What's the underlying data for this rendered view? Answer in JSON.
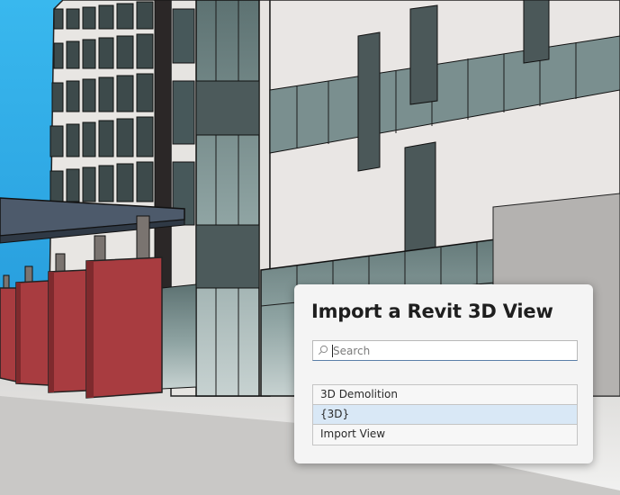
{
  "dialog": {
    "title": "Import a Revit 3D View",
    "search": {
      "placeholder": "Search",
      "value": "",
      "icon": "search-icon"
    },
    "views": [
      {
        "label": "3D Demolition",
        "selected": false
      },
      {
        "label": "{3D}",
        "selected": true
      },
      {
        "label": "Import View",
        "selected": false
      }
    ]
  },
  "colors": {
    "sky": "#2aa6e4",
    "facade": "#e9e6e4",
    "glass": "#6e8586",
    "canopy_panels": "#a83c40",
    "dialog_bg": "#f4f4f4",
    "selection": "#d9e8f6"
  }
}
